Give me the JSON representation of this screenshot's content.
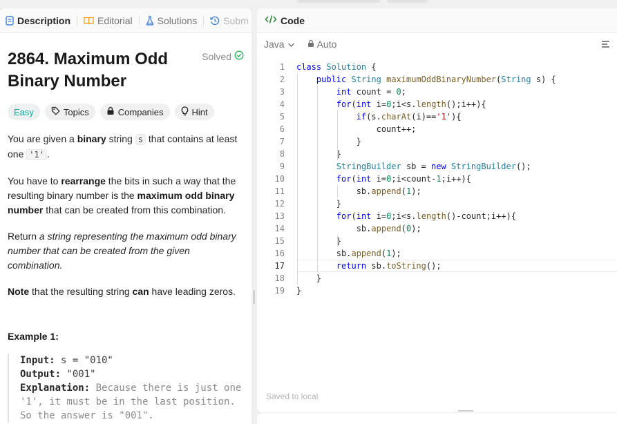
{
  "left": {
    "tabs": [
      {
        "label": "Description",
        "icon": "description-icon"
      },
      {
        "label": "Editorial",
        "icon": "book-icon"
      },
      {
        "label": "Solutions",
        "icon": "flask-icon"
      },
      {
        "label": "Subm",
        "icon": "history-icon"
      }
    ],
    "problem": {
      "title": "2864. Maximum Odd Binary Number",
      "status": "Solved",
      "difficulty": "Easy",
      "chips": [
        "Topics",
        "Companies",
        "Hint"
      ]
    },
    "description": {
      "p1_a": "You are given a ",
      "p1_b": "binary",
      "p1_c": " string ",
      "p1_code1": "s",
      "p1_d": " that contains at least one ",
      "p1_code2": "'1'",
      "p1_e": ".",
      "p2_a": "You have to ",
      "p2_b": "rearrange",
      "p2_c": " the bits in such a way that the resulting binary number is the ",
      "p2_d": "maximum odd binary number",
      "p2_e": " that can be created from this combination.",
      "p3_a": "Return ",
      "p3_b": "a string representing the maximum odd binary number that can be created from the given combination.",
      "p4_a": "Note",
      "p4_b": " that the resulting string ",
      "p4_c": "can",
      "p4_d": " have leading zeros."
    },
    "example": {
      "title": "Example 1:",
      "input_label": "Input:",
      "input_value": " s = \"010\"",
      "output_label": "Output:",
      "output_value": " \"001\"",
      "explanation_label": "Explanation:",
      "explanation_value": " Because there is just one '1', it must be in the last position. So the answer is \"001\"."
    }
  },
  "right": {
    "header": {
      "label": "Code",
      "icon": "code-icon"
    },
    "toolbar": {
      "language": "Java",
      "mode": "Auto"
    },
    "current_line": 17,
    "code_lines": [
      "class Solution {",
      "    public String maximumOddBinaryNumber(String s) {",
      "        int count = 0;",
      "        for(int i=0;i<s.length();i++){",
      "            if(s.charAt(i)=='1'){",
      "                count++;",
      "            }",
      "        }",
      "        StringBuilder sb = new StringBuilder();",
      "        for(int i=0;i<count-1;i++){",
      "            sb.append(1);",
      "        }",
      "        for(int i=0;i<s.length()-count;i++){",
      "            sb.append(0);",
      "        }",
      "        sb.append(1);",
      "        return sb.toString();",
      "    }",
      "}"
    ],
    "saved_status": "Saved to local"
  },
  "colors": {
    "easy": "#00af9b",
    "solved": "#2cbb5d",
    "code_icon": "#2d8c3c",
    "keyword": "#0000ff",
    "type": "#267f99",
    "string": "#a31515",
    "number": "#098658"
  }
}
